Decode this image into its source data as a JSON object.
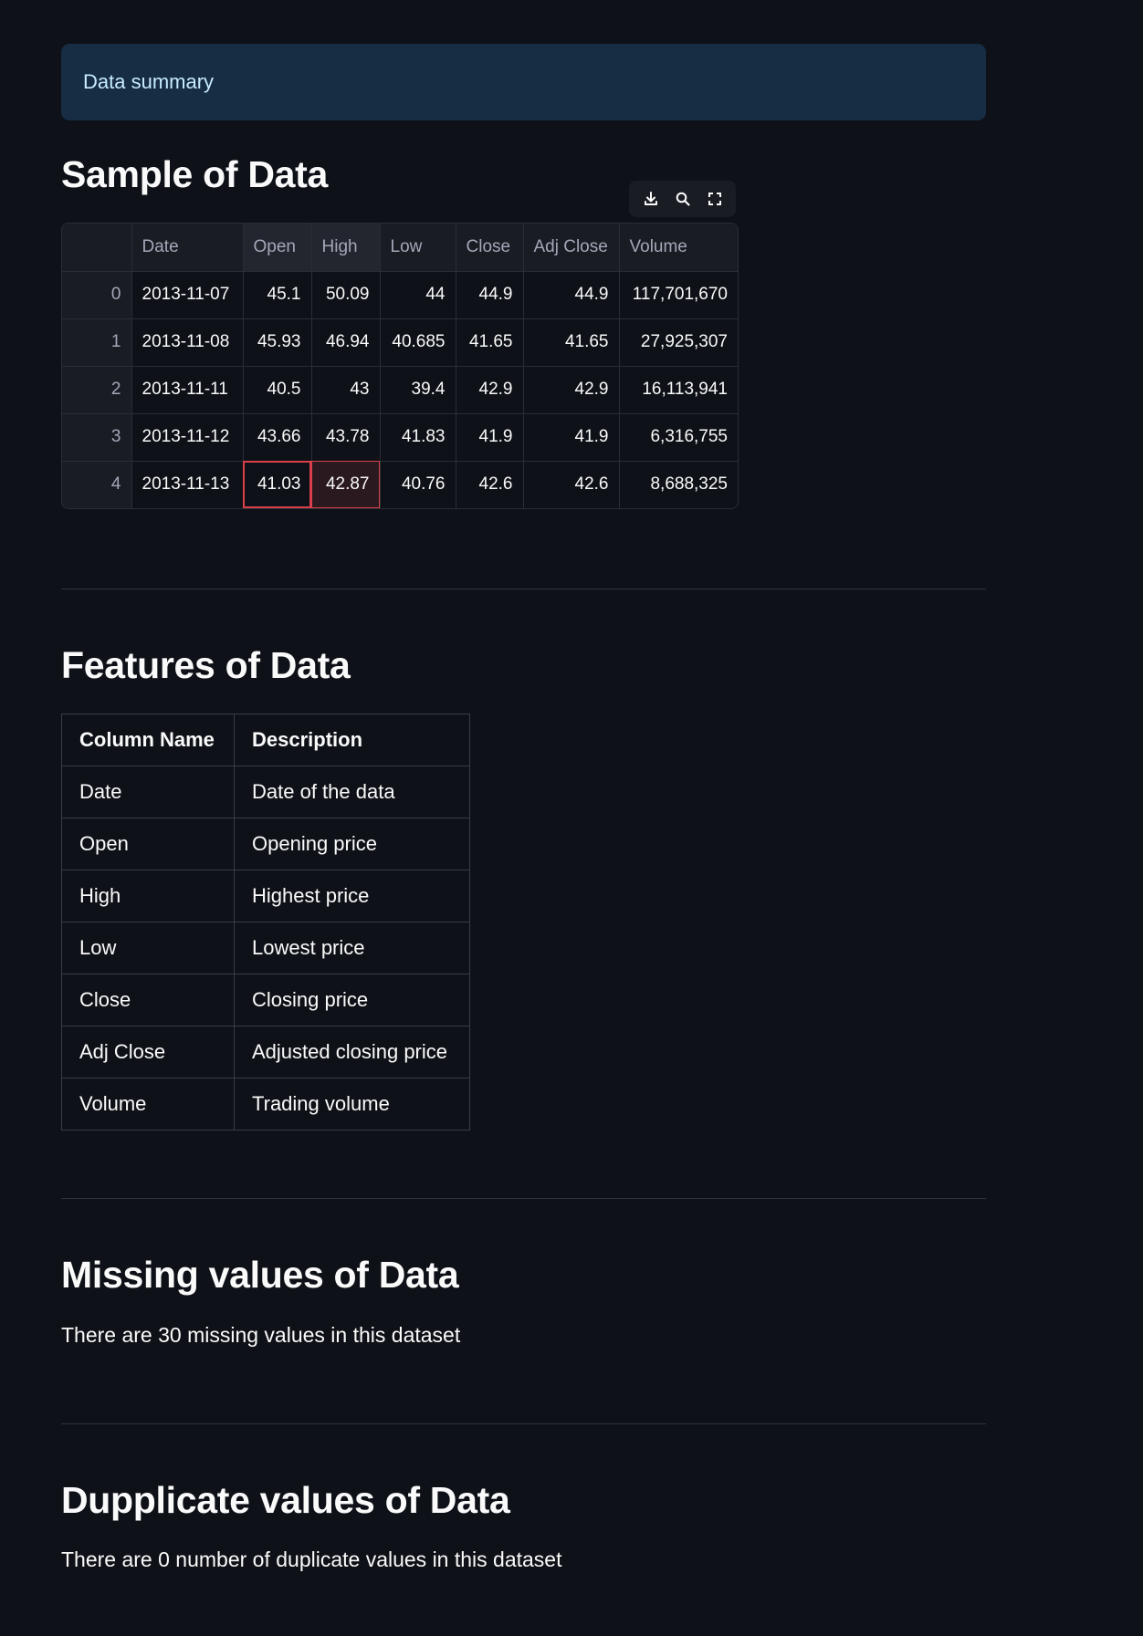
{
  "info": {
    "text": "Data summary"
  },
  "sample": {
    "title": "Sample of Data",
    "toolbar": {
      "download_icon": "download-icon",
      "search_icon": "search-icon",
      "fullscreen_icon": "fullscreen-icon"
    },
    "columns": [
      "",
      "Date",
      "Open",
      "High",
      "Low",
      "Close",
      "Adj Close",
      "Volume"
    ],
    "rows": [
      [
        "0",
        "2013-11-07",
        "45.1",
        "50.09",
        "44",
        "44.9",
        "44.9",
        "117,701,670"
      ],
      [
        "1",
        "2013-11-08",
        "45.93",
        "46.94",
        "40.685",
        "41.65",
        "41.65",
        "27,925,307"
      ],
      [
        "2",
        "2013-11-11",
        "40.5",
        "43",
        "39.4",
        "42.9",
        "42.9",
        "16,113,941"
      ],
      [
        "3",
        "2013-11-12",
        "43.66",
        "43.78",
        "41.83",
        "41.9",
        "41.9",
        "6,316,755"
      ],
      [
        "4",
        "2013-11-13",
        "41.03",
        "42.87",
        "40.76",
        "42.6",
        "42.6",
        "8,688,325"
      ]
    ]
  },
  "features": {
    "title": "Features of Data",
    "headers": [
      "Column Name",
      "Description"
    ],
    "rows": [
      [
        "Date",
        "Date of the data"
      ],
      [
        "Open",
        "Opening price"
      ],
      [
        "High",
        "Highest price"
      ],
      [
        "Low",
        "Lowest price"
      ],
      [
        "Close",
        "Closing price"
      ],
      [
        "Adj Close",
        "Adjusted closing price"
      ],
      [
        "Volume",
        "Trading volume"
      ]
    ]
  },
  "missing": {
    "title": "Missing values of Data",
    "text": "There are 30 missing values in this dataset"
  },
  "duplicates": {
    "title": "Dupplicate values of Data",
    "text": "There are 0 number of duplicate values in this dataset"
  },
  "colors": {
    "background": "#0e1117",
    "info_bg": "#172d43",
    "info_text": "#c7ebff",
    "selection": "#d9404a"
  }
}
